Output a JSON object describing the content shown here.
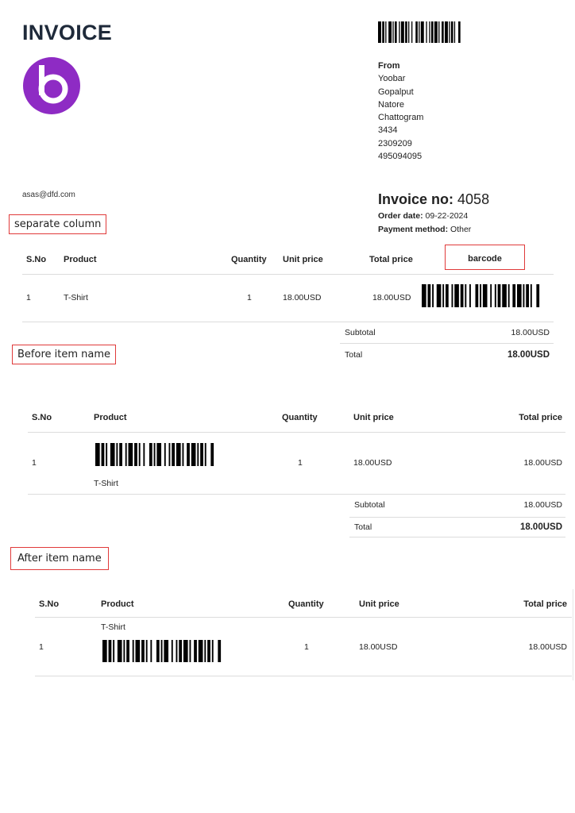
{
  "header": {
    "title": "INVOICE",
    "from_label": "From",
    "from_lines": [
      "Yoobar",
      "Gopalput",
      "Natore",
      "Chattogram",
      "3434",
      "2309209",
      "495094095"
    ],
    "email": "asas@dfd.com",
    "invoice_no_label": "Invoice no:",
    "invoice_no": "4058",
    "order_date_label": "Order date:",
    "order_date": "09-22-2024",
    "payment_method_label": "Payment method:",
    "payment_method": "Other"
  },
  "colors": {
    "logo": "#8e2bc4",
    "callout_border": "#e03a3a",
    "title": "#1f2a3a"
  },
  "callouts": {
    "separate_column": "separate column",
    "before_item_name": "Before item name",
    "after_item_name": "After item name"
  },
  "table1": {
    "headers": {
      "sno": "S.No",
      "product": "Product",
      "quantity": "Quantity",
      "unit_price": "Unit price",
      "total_price": "Total price",
      "barcode": "barcode"
    },
    "row": {
      "sno": "1",
      "product": "T-Shirt",
      "quantity": "1",
      "unit_price": "18.00USD",
      "total_price": "18.00USD"
    },
    "subtotal_label": "Subtotal",
    "subtotal": "18.00USD",
    "total_label": "Total",
    "total": "18.00USD"
  },
  "table2": {
    "headers": {
      "sno": "S.No",
      "product": "Product",
      "quantity": "Quantity",
      "unit_price": "Unit price",
      "total_price": "Total price"
    },
    "row": {
      "sno": "1",
      "product": "T-Shirt",
      "quantity": "1",
      "unit_price": "18.00USD",
      "total_price": "18.00USD"
    },
    "subtotal_label": "Subtotal",
    "subtotal": "18.00USD",
    "total_label": "Total",
    "total": "18.00USD"
  },
  "table3": {
    "headers": {
      "sno": "S.No",
      "product": "Product",
      "quantity": "Quantity",
      "unit_price": "Unit price",
      "total_price": "Total price"
    },
    "row": {
      "sno": "1",
      "product": "T-Shirt",
      "quantity": "1",
      "unit_price": "18.00USD",
      "total_price": "18.00USD"
    }
  }
}
